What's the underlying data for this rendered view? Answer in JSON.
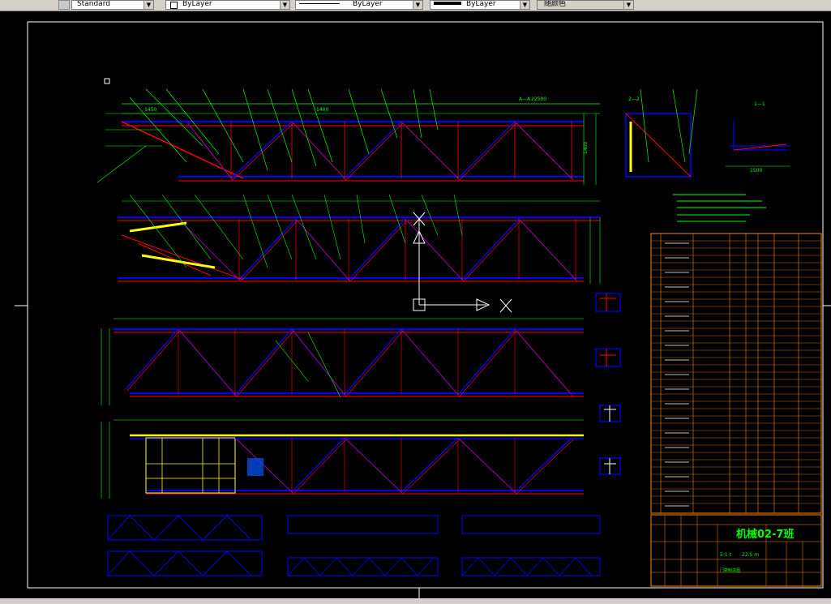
{
  "toolbar": {
    "text_style": "Standard",
    "layer": "ByLayer",
    "linetype": "ByLayer",
    "lineweight": "ByLayer",
    "plot_style": "随颜色"
  },
  "drawing": {
    "title_block_name": "机械02-7班",
    "section_aa": "A—A",
    "section_22": "2—2",
    "section_11": "1—1",
    "overall_length": "22500",
    "panel_len": "1400",
    "end_len": "1450",
    "height_label": "1400",
    "width_label": "1500",
    "tb_scale_value": "22.5 m",
    "tb_qty": "5 1 t",
    "tb_footer": "门架制造图"
  }
}
